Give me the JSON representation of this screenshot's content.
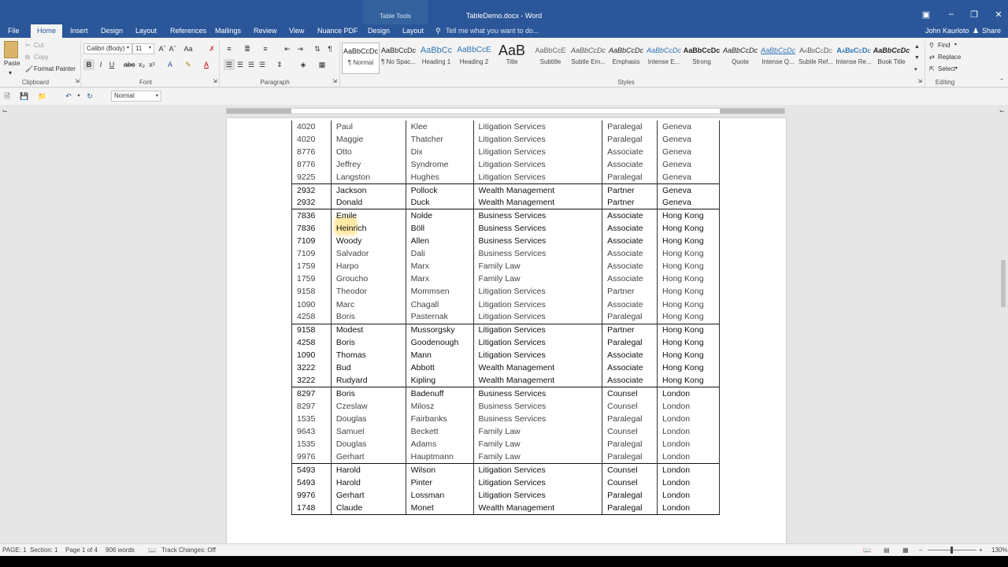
{
  "titlebar": {
    "context_label": "Table Tools",
    "doc_title": "TableDemo.docx - Word",
    "ribbon_display_icon": "ribbon-display-icon",
    "minimize_icon": "minimize-icon",
    "restore_icon": "restore-icon",
    "close_icon": "close-icon"
  },
  "tabs": {
    "file": "File",
    "home": "Home",
    "insert": "Insert",
    "design": "Design",
    "layout": "Layout",
    "references": "References",
    "mailings": "Mailings",
    "review": "Review",
    "view": "View",
    "nuance": "Nuance PDF",
    "table_design": "Design",
    "table_layout": "Layout",
    "tell_me": "Tell me what you want to do...",
    "user": "John Kaurloto",
    "share": "Share"
  },
  "ribbon": {
    "clipboard": {
      "paste": "Paste",
      "cut": "Cut",
      "copy": "Copy",
      "format_painter": "Format Painter",
      "label": "Clipboard"
    },
    "font": {
      "name": "Calibri (Body)",
      "size": "11",
      "label": "Font"
    },
    "paragraph": {
      "label": "Paragraph"
    },
    "styles": {
      "label": "Styles",
      "items": [
        {
          "preview": "AaBbCcDc",
          "name": "¶ Normal"
        },
        {
          "preview": "AaBbCcDc",
          "name": "¶ No Spac..."
        },
        {
          "preview": "AaBbCc",
          "name": "Heading 1"
        },
        {
          "preview": "AaBbCcE",
          "name": "Heading 2"
        },
        {
          "preview": "AaB",
          "name": "Title"
        },
        {
          "preview": "AaBbCcE",
          "name": "Subtitle"
        },
        {
          "preview": "AaBbCcDc",
          "name": "Subtle Em..."
        },
        {
          "preview": "AaBbCcDc",
          "name": "Emphasis"
        },
        {
          "preview": "AaBbCcDc",
          "name": "Intense E..."
        },
        {
          "preview": "AaBbCcDc",
          "name": "Strong"
        },
        {
          "preview": "AaBbCcDc",
          "name": "Quote"
        },
        {
          "preview": "AaBbCcDc",
          "name": "Intense Q..."
        },
        {
          "preview": "AaBbCcDc",
          "name": "Subtle Ref..."
        },
        {
          "preview": "AaBbCcDc",
          "name": "Intense Re..."
        },
        {
          "preview": "AaBbCcDc",
          "name": "Book Title"
        }
      ]
    },
    "editing": {
      "find": "Find",
      "replace": "Replace",
      "select": "Select",
      "label": "Editing"
    }
  },
  "qat": {
    "style_value": "Normal"
  },
  "table": {
    "rows": [
      [
        "4020",
        "Paul",
        "Klee",
        "Litigation Services",
        "Paralegal",
        "Geneva"
      ],
      [
        "4020",
        "Maggie",
        "Thatcher",
        "Litigation Services",
        "Paralegal",
        "Geneva"
      ],
      [
        "8776",
        "Otto",
        "Dix",
        "Litigation Services",
        "Associate",
        "Geneva"
      ],
      [
        "8776",
        "Jeffrey",
        "Syndrome",
        "Litigation Services",
        "Associate",
        "Geneva"
      ],
      [
        "9225",
        "Langston",
        "Hughes",
        "Litigation Services",
        "Paralegal",
        "Geneva"
      ],
      [
        "2932",
        "Jackson",
        "Pollock",
        "Wealth Management",
        "Partner",
        "Geneva"
      ],
      [
        "2932",
        "Donald",
        "Duck",
        "Wealth Management",
        "Partner",
        "Geneva"
      ],
      [
        "7836",
        "Emile",
        "Nolde",
        "Business Services",
        "Associate",
        "Hong Kong"
      ],
      [
        "7836",
        "Heinrich",
        "Böll",
        "Business Services",
        "Associate",
        "Hong Kong"
      ],
      [
        "7109",
        "Woody",
        "Allen",
        "Business Services",
        "Associate",
        "Hong Kong"
      ],
      [
        "7109",
        "Salvador",
        "Dali",
        "Business Services",
        "Associate",
        "Hong Kong"
      ],
      [
        "1759",
        "Harpo",
        "Marx",
        "Family Law",
        "Associate",
        "Hong Kong"
      ],
      [
        "1759",
        "Groucho",
        "Marx",
        "Family Law",
        "Associate",
        "Hong Kong"
      ],
      [
        "9158",
        "Theodor",
        "Mommsen",
        "Litigation Services",
        "Partner",
        "Hong Kong"
      ],
      [
        "1090",
        "Marc",
        "Chagall",
        "Litigation Services",
        "Associate",
        "Hong Kong"
      ],
      [
        "4258",
        "Boris",
        "Pasternak",
        "Litigation Services",
        "Paralegal",
        "Hong Kong"
      ],
      [
        "9158",
        "Modest",
        "Mussorgsky",
        "Litigation Services",
        "Partner",
        "Hong Kong"
      ],
      [
        "4258",
        "Boris",
        "Goodenough",
        "Litigation Services",
        "Paralegal",
        "Hong Kong"
      ],
      [
        "1090",
        "Thomas",
        "Mann",
        "Litigation Services",
        "Associate",
        "Hong Kong"
      ],
      [
        "3222",
        "Bud",
        "Abbott",
        "Wealth Management",
        "Associate",
        "Hong Kong"
      ],
      [
        "3222",
        "Rudyard",
        "Kipling",
        "Wealth Management",
        "Associate",
        "Hong Kong"
      ],
      [
        "8297",
        "Boris",
        "Badenuff",
        "Business Services",
        "Counsel",
        "London"
      ],
      [
        "8297",
        "Czeslaw",
        "Milosz",
        "Business Services",
        "Counsel",
        "London"
      ],
      [
        "1535",
        "Douglas",
        "Fairbanks",
        "Business Services",
        "Paralegal",
        "London"
      ],
      [
        "9643",
        "Samuel",
        "Beckett",
        "Family Law",
        "Counsel",
        "London"
      ],
      [
        "1535",
        "Douglas",
        "Adams",
        "Family Law",
        "Paralegal",
        "London"
      ],
      [
        "9976",
        "Gerhart",
        "Hauptmann",
        "Family Law",
        "Paralegal",
        "London"
      ],
      [
        "5493",
        "Harold",
        "Wilson",
        "Litigation Services",
        "Counsel",
        "London"
      ],
      [
        "5493",
        "Harold",
        "Pinter",
        "Litigation Services",
        "Counsel",
        "London"
      ],
      [
        "9976",
        "Gerhart",
        "Lossman",
        "Litigation Services",
        "Paralegal",
        "London"
      ],
      [
        "1748",
        "Claude",
        "Monet",
        "Wealth Management",
        "Paralegal",
        "London"
      ]
    ]
  },
  "status": {
    "page": "PAGE: 1",
    "section": "Section: 1",
    "page_of": "Page 1 of 4",
    "words": "906 words",
    "track": "Track Changes: Off",
    "zoom": "130%"
  }
}
